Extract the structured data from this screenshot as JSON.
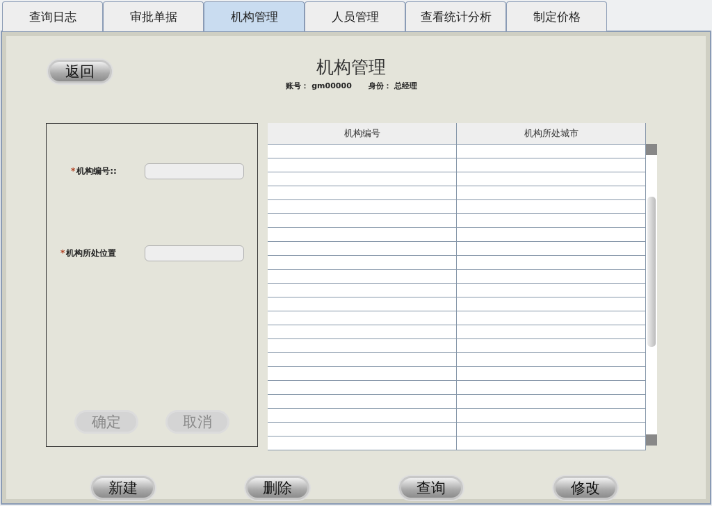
{
  "tabs": [
    {
      "label": "查询日志",
      "selected": false
    },
    {
      "label": "审批单据",
      "selected": false
    },
    {
      "label": "机构管理",
      "selected": true
    },
    {
      "label": "人员管理",
      "selected": false
    },
    {
      "label": "查看统计分析",
      "selected": false
    },
    {
      "label": "制定价格",
      "selected": false
    }
  ],
  "back_button": "返回",
  "title": "机构管理",
  "account": {
    "label": "账号：",
    "value": "gm00000"
  },
  "role": {
    "label": "身份：",
    "value": "总经理"
  },
  "form": {
    "fields": [
      {
        "required_mark": "*",
        "label": "机构编号::"
      },
      {
        "required_mark": "*",
        "label": "机构所处位置"
      }
    ],
    "buttons": [
      {
        "label": "确定",
        "disabled": true
      },
      {
        "label": "取消",
        "disabled": true
      }
    ]
  },
  "table": {
    "columns": [
      "机构编号",
      "机构所处城市"
    ]
  },
  "actions": [
    "新建",
    "删除",
    "查询",
    "修改"
  ]
}
